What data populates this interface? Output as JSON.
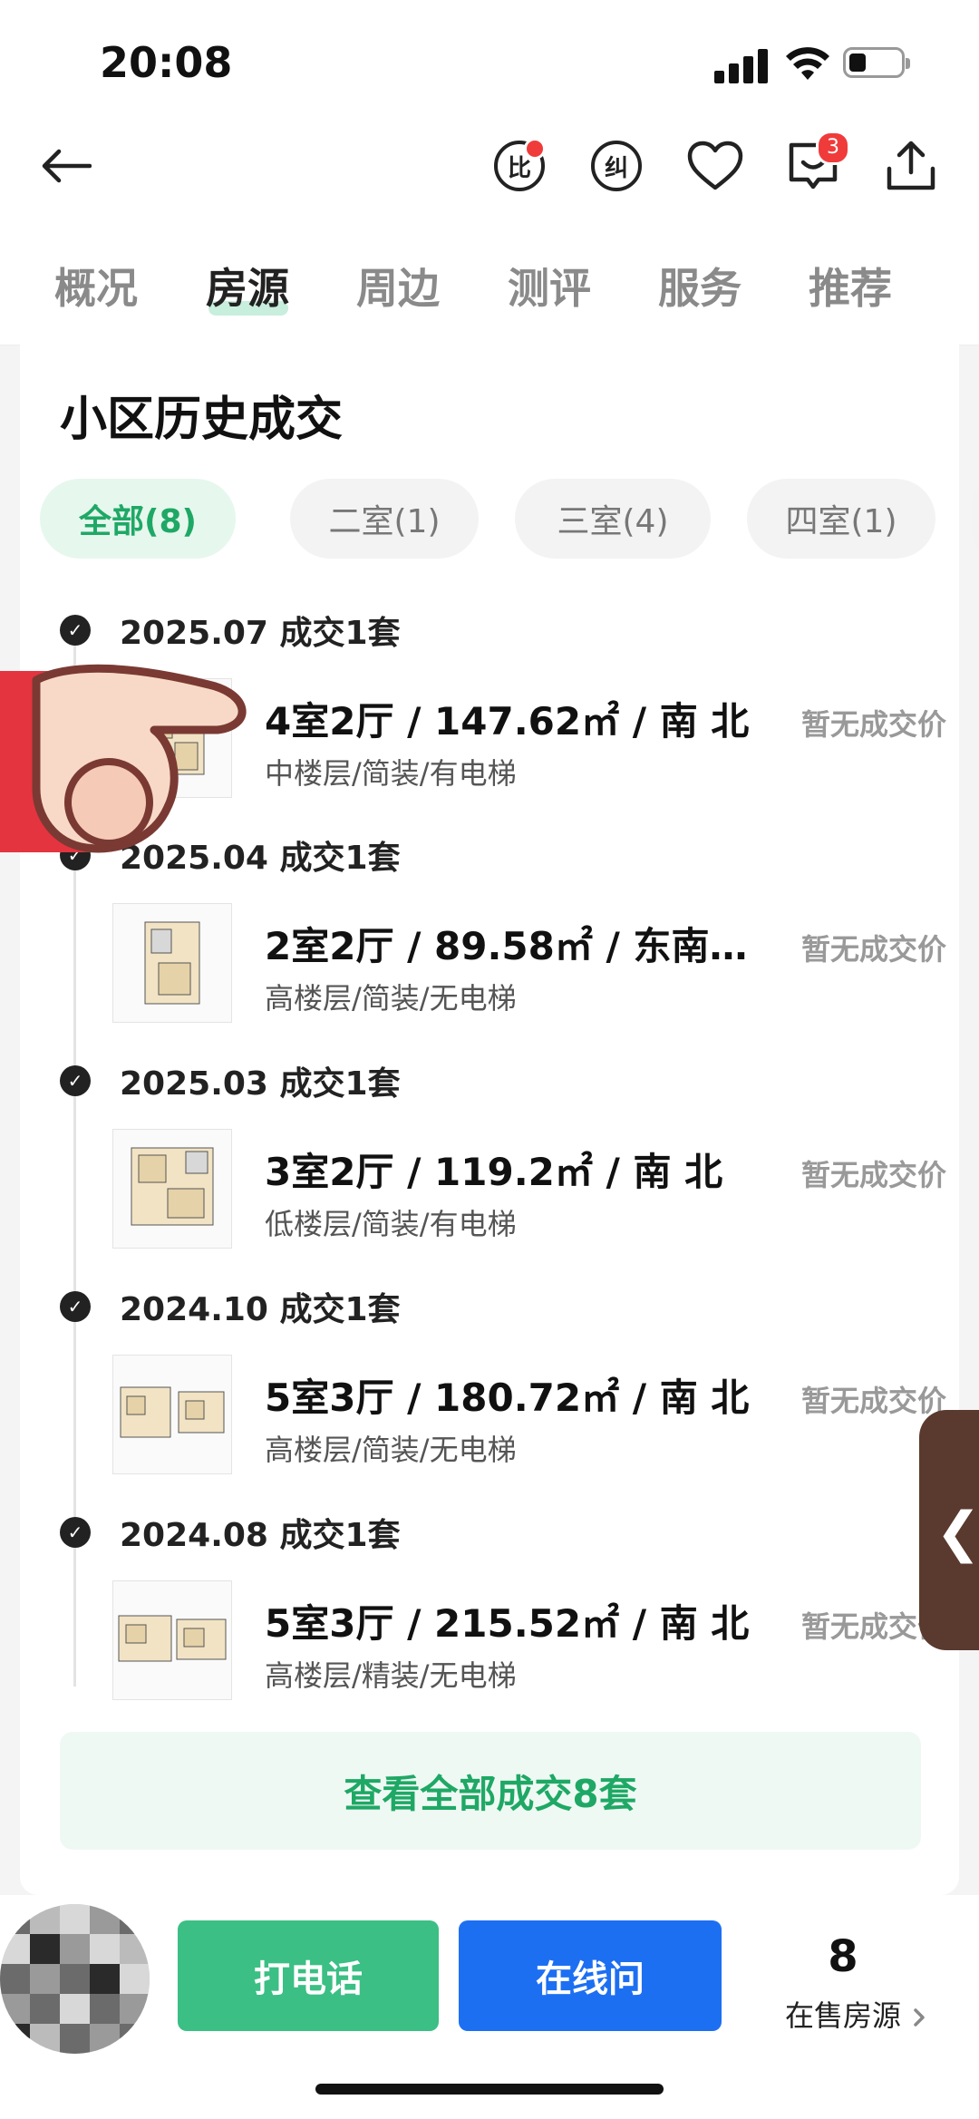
{
  "status_bar": {
    "time": "20:08"
  },
  "top_bar": {
    "compare_label": "比",
    "correct_label": "纠",
    "message_badge": "3"
  },
  "tabs": [
    {
      "label": "概况"
    },
    {
      "label": "房源",
      "active": true
    },
    {
      "label": "周边"
    },
    {
      "label": "测评"
    },
    {
      "label": "服务"
    },
    {
      "label": "推荐"
    }
  ],
  "section": {
    "title": "小区历史成交",
    "filters": [
      "全部(8)",
      "二室(1)",
      "三室(4)",
      "四室(1)"
    ],
    "groups": [
      {
        "date": "2025.07 成交1套",
        "title": "4室2厅 / 147.62㎡ / 南 北",
        "sub": "中楼层/简装/有电梯",
        "price": "暂无成交价"
      },
      {
        "date": "2025.04 成交1套",
        "title": "2室2厅 / 89.58㎡ / 东南…",
        "sub": "高楼层/简装/无电梯",
        "price": "暂无成交价"
      },
      {
        "date": "2025.03 成交1套",
        "title": "3室2厅 / 119.2㎡ / 南 北",
        "sub": "低楼层/简装/有电梯",
        "price": "暂无成交价"
      },
      {
        "date": "2024.10 成交1套",
        "title": "5室3厅 / 180.72㎡ / 南 北",
        "sub": "高楼层/简装/无电梯",
        "price": "暂无成交价"
      },
      {
        "date": "2024.08 成交1套",
        "title": "5室3厅 / 215.52㎡ / 南 北",
        "sub": "高楼层/精装/无电梯",
        "price": "暂无成交价"
      }
    ],
    "view_all": "查看全部成交8套"
  },
  "side_tab": {
    "glyph": "❮"
  },
  "bottom_bar": {
    "call": "打电话",
    "chat": "在线问",
    "sale_count": "8",
    "sale_label": "在售房源"
  },
  "colors": {
    "accent_green": "#1fa865",
    "call_green": "#3bbf84",
    "chat_blue": "#1d6ff2",
    "badge_red": "#f03b3b"
  }
}
